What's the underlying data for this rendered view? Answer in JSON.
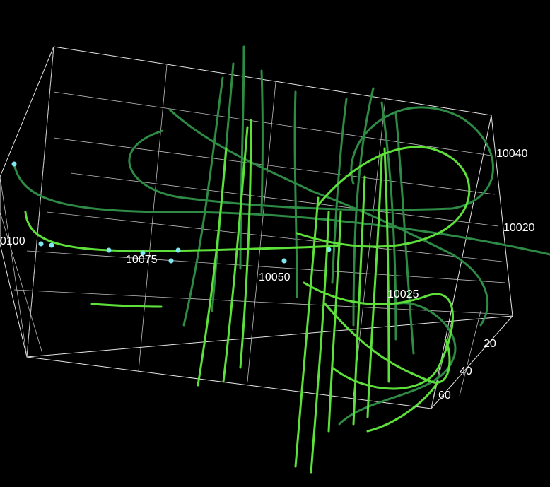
{
  "colors": {
    "background": "#000000",
    "box_lines": "#e6e6e6",
    "trace_dark": "#2e8b45",
    "trace_light": "#5ee03a",
    "marker": "#7ee8f0"
  },
  "axes": {
    "x_ticks": [
      "0100",
      "10075",
      "10050",
      "10025"
    ],
    "y_ticks": [
      "10040",
      "10020"
    ],
    "z_ticks": [
      "20",
      "40",
      "60"
    ]
  }
}
